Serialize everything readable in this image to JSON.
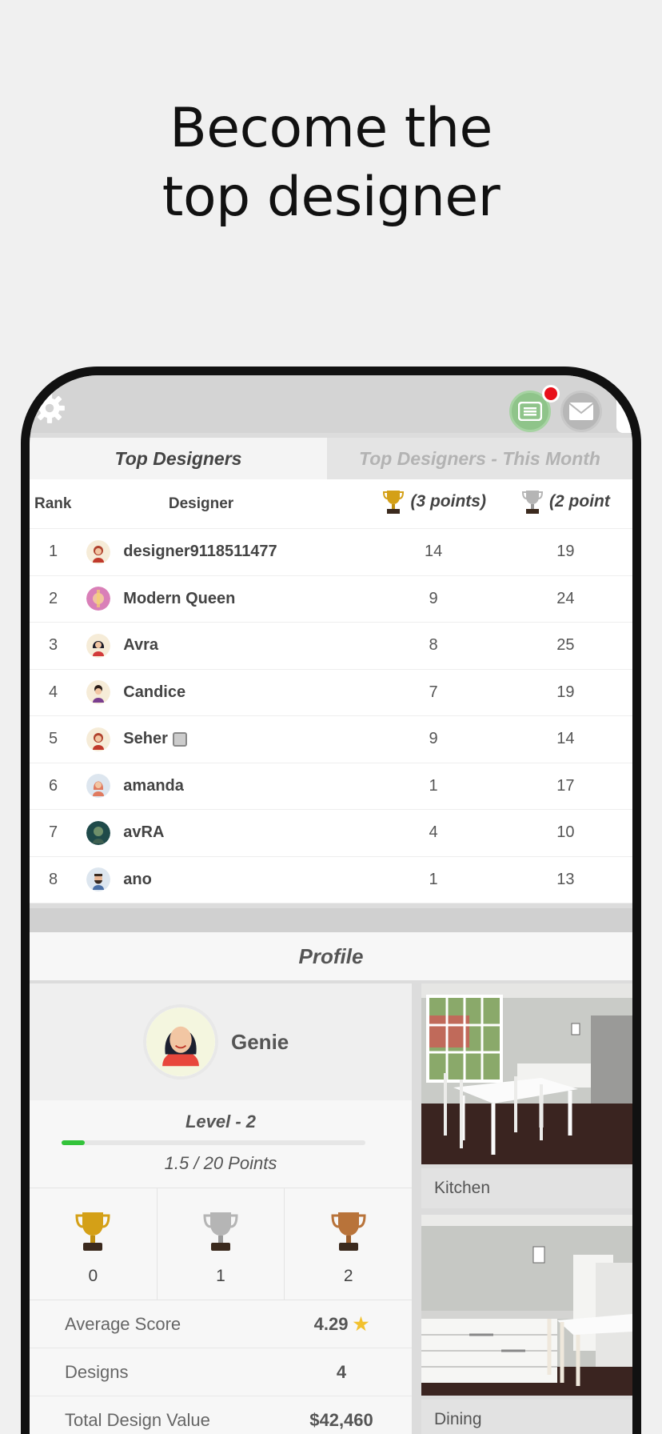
{
  "headline": {
    "line1": "Become the",
    "line2": "top designer"
  },
  "topbar": {
    "settings_icon": "gear-icon",
    "messages_icon": "chat-icon",
    "mail_icon": "mail-icon",
    "notification": true
  },
  "tabs": [
    {
      "label": "Top Designers",
      "active": true
    },
    {
      "label": "Top Designers - This Month",
      "active": false
    }
  ],
  "leaderboard": {
    "headers": {
      "rank": "Rank",
      "designer": "Designer",
      "gold": "(3 points)",
      "silver": "(2 point"
    },
    "rows": [
      {
        "rank": "1",
        "name": "designer9118511477",
        "gold": "14",
        "silver": "19"
      },
      {
        "rank": "2",
        "name": "Modern Queen",
        "gold": "9",
        "silver": "24"
      },
      {
        "rank": "3",
        "name": "Avra",
        "gold": "8",
        "silver": "25"
      },
      {
        "rank": "4",
        "name": "Candice",
        "gold": "7",
        "silver": "19"
      },
      {
        "rank": "5",
        "name": "Seher",
        "gold": "9",
        "silver": "14"
      },
      {
        "rank": "6",
        "name": "amanda",
        "gold": "1",
        "silver": "17"
      },
      {
        "rank": "7",
        "name": "avRA",
        "gold": "4",
        "silver": "10"
      },
      {
        "rank": "8",
        "name": "ano",
        "gold": "1",
        "silver": "13"
      }
    ]
  },
  "profile": {
    "title": "Profile",
    "name": "Genie",
    "level": "Level - 2",
    "points": "1.5 / 20 Points",
    "progress": 0.075,
    "trophies": {
      "gold": "0",
      "silver": "1",
      "bronze": "2"
    },
    "stats": [
      {
        "label": "Average Score",
        "value": "4.29"
      },
      {
        "label": "Designs",
        "value": "4"
      },
      {
        "label": "Total Design Value",
        "value": "$42,460"
      }
    ],
    "designs": [
      {
        "caption": "Kitchen"
      },
      {
        "caption": "Dining"
      }
    ]
  },
  "colors": {
    "gold": "#d4a017",
    "silver": "#b5b5b5",
    "bronze": "#b8733a",
    "accent_green": "#33c33a",
    "notif_red": "#e8101a"
  }
}
